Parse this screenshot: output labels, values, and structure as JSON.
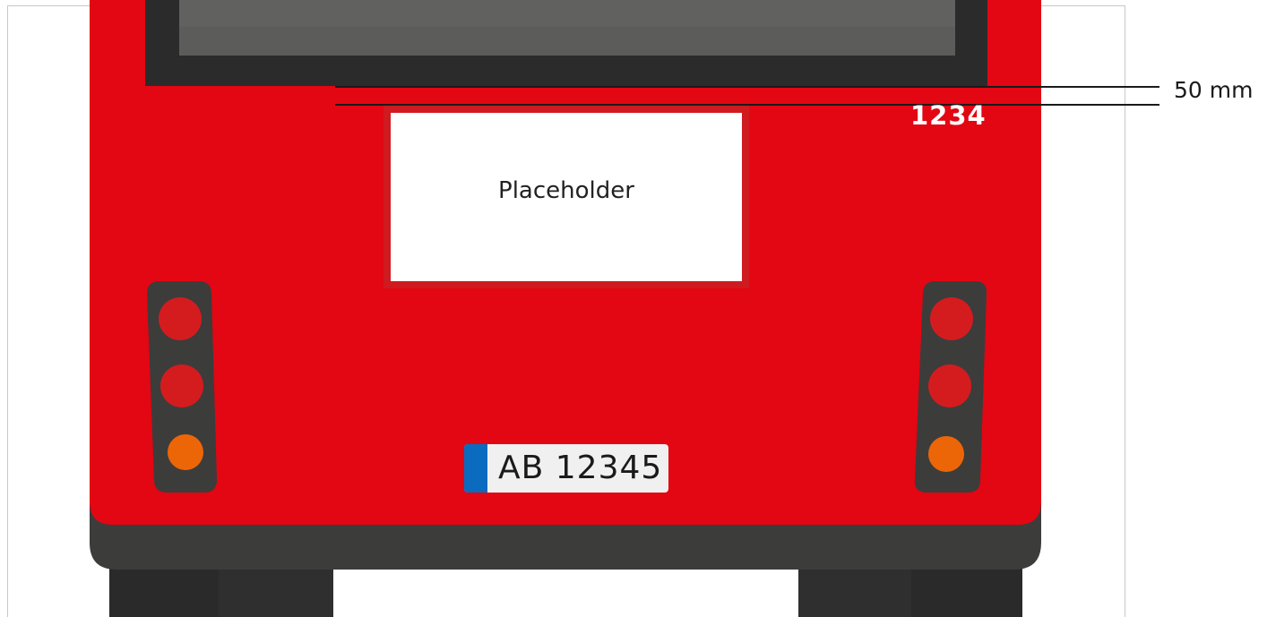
{
  "dimension": {
    "label": "50 mm"
  },
  "bus": {
    "fleet_number": "1234",
    "display_placeholder": "Placeholder",
    "license_plate": "AB 12345"
  },
  "colors": {
    "body": "#e30613",
    "bumper": "#3c3c3b",
    "window_frame": "#2b2b2b",
    "window_glass": "#5a5a5a",
    "wheels": "#2a2a2a",
    "brake_light": "#d41c1f",
    "indicator_light": "#ec6608",
    "plate_blue": "#0a6bbf"
  },
  "icons": {
    "left_tail_light": "tail-light-cluster-icon",
    "right_tail_light": "tail-light-cluster-icon"
  }
}
